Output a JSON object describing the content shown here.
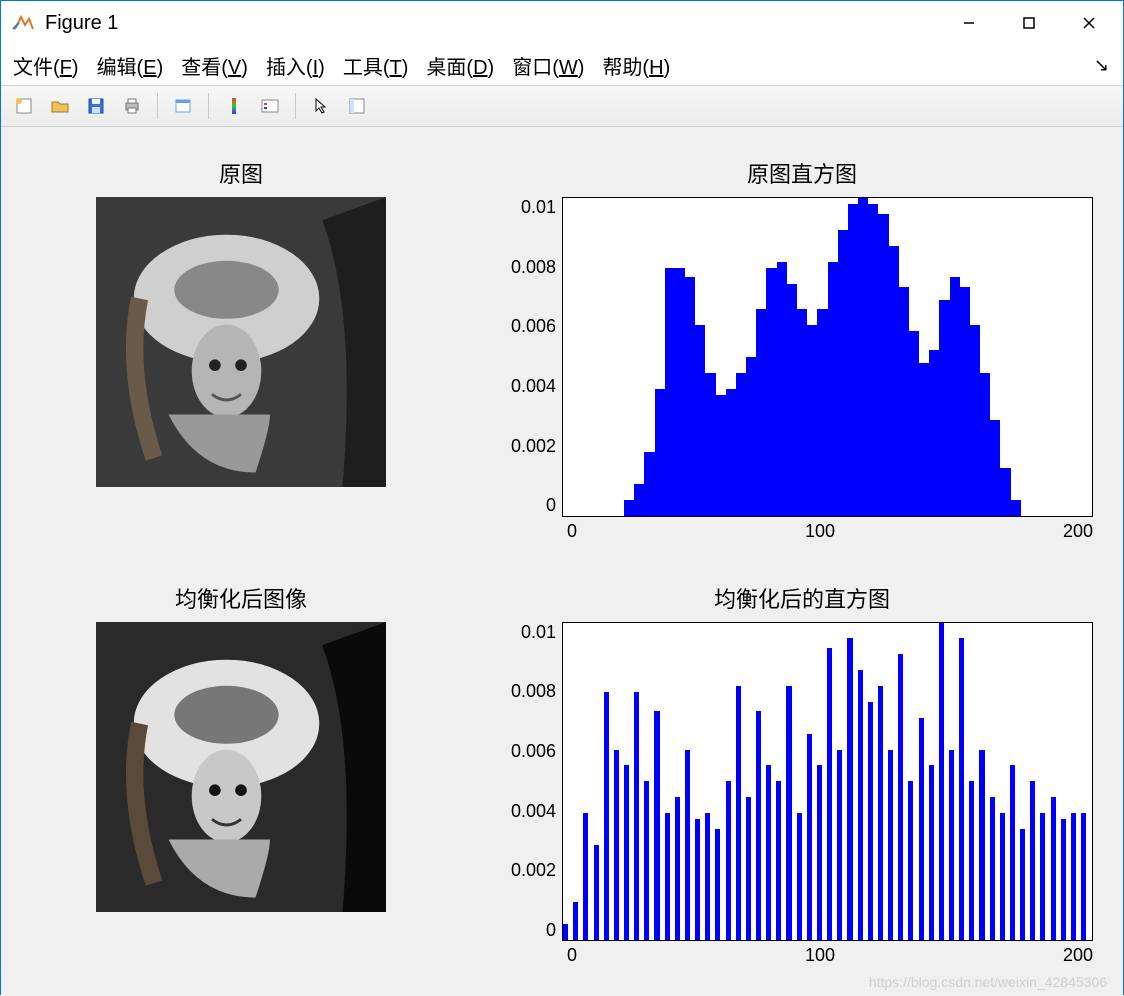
{
  "window": {
    "title": "Figure 1"
  },
  "menu": {
    "file": "文件(F)",
    "edit": "编辑(E)",
    "view": "查看(V)",
    "insert": "插入(I)",
    "tools": "工具(T)",
    "desktop": "桌面(D)",
    "window": "窗口(W)",
    "help": "帮助(H)"
  },
  "subplots": {
    "img1_title": "原图",
    "hist1_title": "原图直方图",
    "img2_title": "均衡化后图像",
    "hist2_title": "均衡化后的直方图"
  },
  "axes": {
    "yticks": [
      "0.01",
      "0.008",
      "0.006",
      "0.004",
      "0.002",
      "0"
    ],
    "xticks": [
      "0",
      "100",
      "200"
    ]
  },
  "watermark": "https://blog.csdn.net/weixin_42845306",
  "chart_data": [
    {
      "type": "bar",
      "title": "原图直方图",
      "xlabel": "",
      "ylabel": "",
      "xlim": [
        0,
        255
      ],
      "ylim": [
        0,
        0.01
      ],
      "x": [
        0,
        5,
        10,
        15,
        20,
        25,
        30,
        35,
        40,
        45,
        50,
        55,
        60,
        65,
        70,
        75,
        80,
        85,
        90,
        95,
        100,
        105,
        110,
        115,
        120,
        125,
        130,
        135,
        140,
        145,
        150,
        155,
        160,
        165,
        170,
        175,
        180,
        185,
        190,
        195,
        200,
        205,
        210,
        215,
        220,
        225,
        230,
        235,
        240,
        245,
        250,
        255
      ],
      "values": [
        0,
        0,
        0,
        0,
        0,
        0,
        0.0005,
        0.001,
        0.002,
        0.004,
        0.0078,
        0.0078,
        0.0075,
        0.006,
        0.0045,
        0.0038,
        0.004,
        0.0045,
        0.005,
        0.0065,
        0.0078,
        0.008,
        0.0073,
        0.0065,
        0.006,
        0.0065,
        0.008,
        0.009,
        0.0098,
        0.0102,
        0.0098,
        0.0095,
        0.0085,
        0.0072,
        0.0058,
        0.0048,
        0.0052,
        0.0068,
        0.0075,
        0.0072,
        0.006,
        0.0045,
        0.003,
        0.0015,
        0.0005,
        0,
        0,
        0,
        0,
        0,
        0,
        0
      ]
    },
    {
      "type": "bar",
      "title": "均衡化后的直方图",
      "xlabel": "",
      "ylabel": "",
      "xlim": [
        0,
        255
      ],
      "ylim": [
        0,
        0.01
      ],
      "x": [
        0,
        5,
        10,
        15,
        20,
        25,
        30,
        35,
        40,
        45,
        50,
        55,
        60,
        65,
        70,
        75,
        80,
        85,
        90,
        95,
        100,
        105,
        110,
        115,
        120,
        125,
        130,
        135,
        140,
        145,
        150,
        155,
        160,
        165,
        170,
        175,
        180,
        185,
        190,
        195,
        200,
        205,
        210,
        215,
        220,
        225,
        230,
        235,
        240,
        245,
        250,
        255
      ],
      "values": [
        0.0005,
        0.0012,
        0.004,
        0.003,
        0.0078,
        0.006,
        0.0055,
        0.0078,
        0.005,
        0.0072,
        0.004,
        0.0045,
        0.006,
        0.0038,
        0.004,
        0.0035,
        0.005,
        0.008,
        0.0045,
        0.0072,
        0.0055,
        0.005,
        0.008,
        0.004,
        0.0065,
        0.0055,
        0.0092,
        0.006,
        0.0095,
        0.0085,
        0.0075,
        0.008,
        0.006,
        0.009,
        0.005,
        0.007,
        0.0055,
        0.0102,
        0.006,
        0.0095,
        0.005,
        0.006,
        0.0045,
        0.004,
        0.0055,
        0.0035,
        0.005,
        0.004,
        0.0045,
        0.0038,
        0.004,
        0.004
      ]
    }
  ]
}
